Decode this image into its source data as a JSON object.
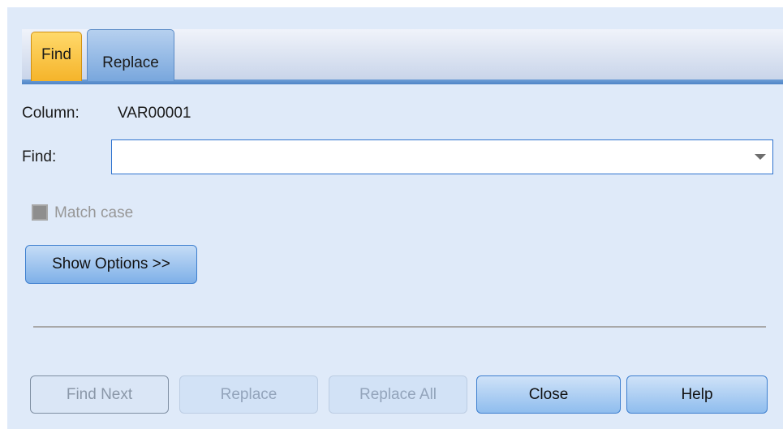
{
  "tabs": [
    {
      "label": "Find",
      "active": true
    },
    {
      "label": "Replace",
      "active": false
    }
  ],
  "column": {
    "label": "Column:",
    "value": "VAR00001"
  },
  "find": {
    "label": "Find:",
    "value": "",
    "placeholder": ""
  },
  "match_case": {
    "label": "Match case",
    "checked": false,
    "enabled": false
  },
  "show_options_label": "Show Options >>",
  "buttons": {
    "find_next": "Find Next",
    "replace": "Replace",
    "replace_all": "Replace All",
    "close": "Close",
    "help": "Help"
  },
  "icons": {
    "combo_arrow": "chevron-down-icon"
  },
  "colors": {
    "active_tab": "#f5b42a",
    "accent": "#4e84c6",
    "dialog_bg": "#dfeaf9"
  }
}
